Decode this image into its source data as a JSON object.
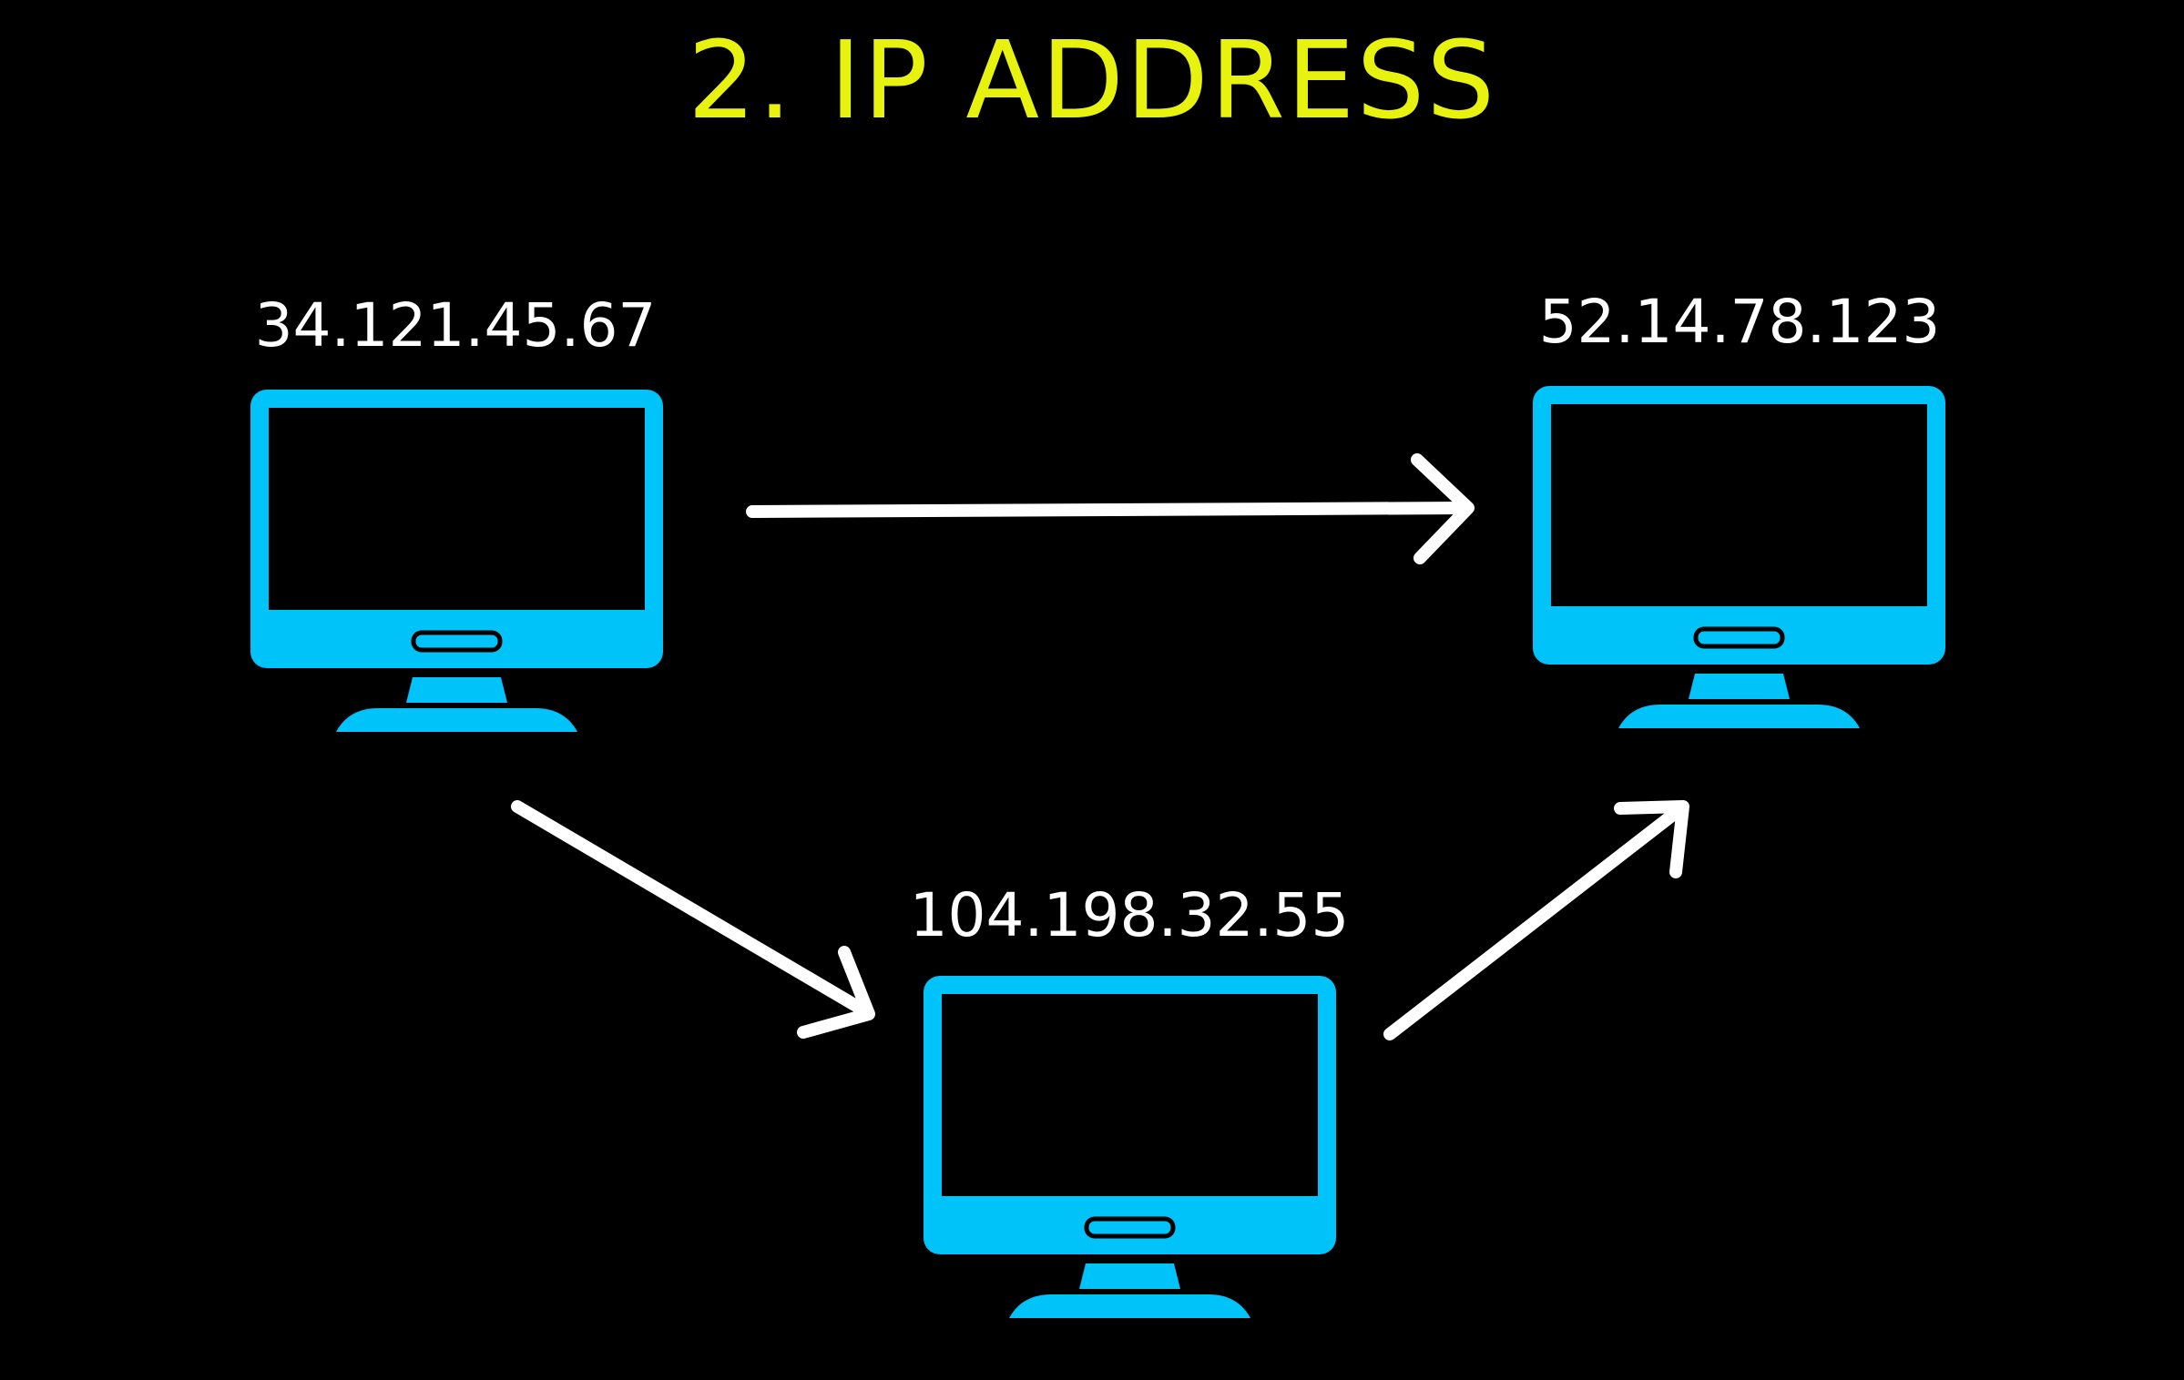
{
  "title": "2. IP ADDRESS",
  "colors": {
    "background": "#000000",
    "title": "#e8f20f",
    "computer": "#00c3fa",
    "arrow": "#ffffff",
    "label": "#ffffff"
  },
  "nodes": {
    "left": {
      "ip": "34.121.45.67",
      "icon": "desktop-computer-icon"
    },
    "right": {
      "ip": "52.14.78.123",
      "icon": "desktop-computer-icon"
    },
    "middle": {
      "ip": "104.198.32.55",
      "icon": "desktop-computer-icon"
    }
  },
  "edges": [
    {
      "from": "34.121.45.67",
      "to": "52.14.78.123"
    },
    {
      "from": "34.121.45.67",
      "to": "104.198.32.55"
    },
    {
      "from": "104.198.32.55",
      "to": "52.14.78.123"
    }
  ]
}
